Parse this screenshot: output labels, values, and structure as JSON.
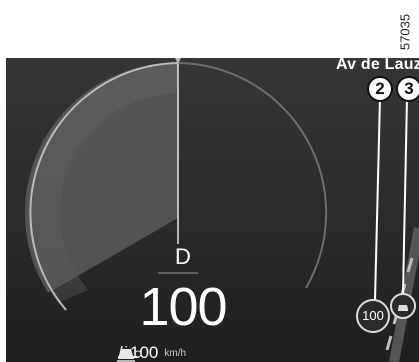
{
  "figure_ref": "57035",
  "street_name": "Av de Lauzun",
  "callouts": [
    "2",
    "3"
  ],
  "gear": "D",
  "speed": "100",
  "speed_limit": {
    "value": "100",
    "unit": "km/h"
  },
  "speed_limit_sign": "100",
  "icons": [
    "lane-assist-icon",
    "cruise-control-icon",
    "vehicle-ahead-icon"
  ],
  "colors": {
    "background": "#2e2e2e",
    "gauge_fill": "#5a5a5a",
    "text": "#ffffff"
  }
}
